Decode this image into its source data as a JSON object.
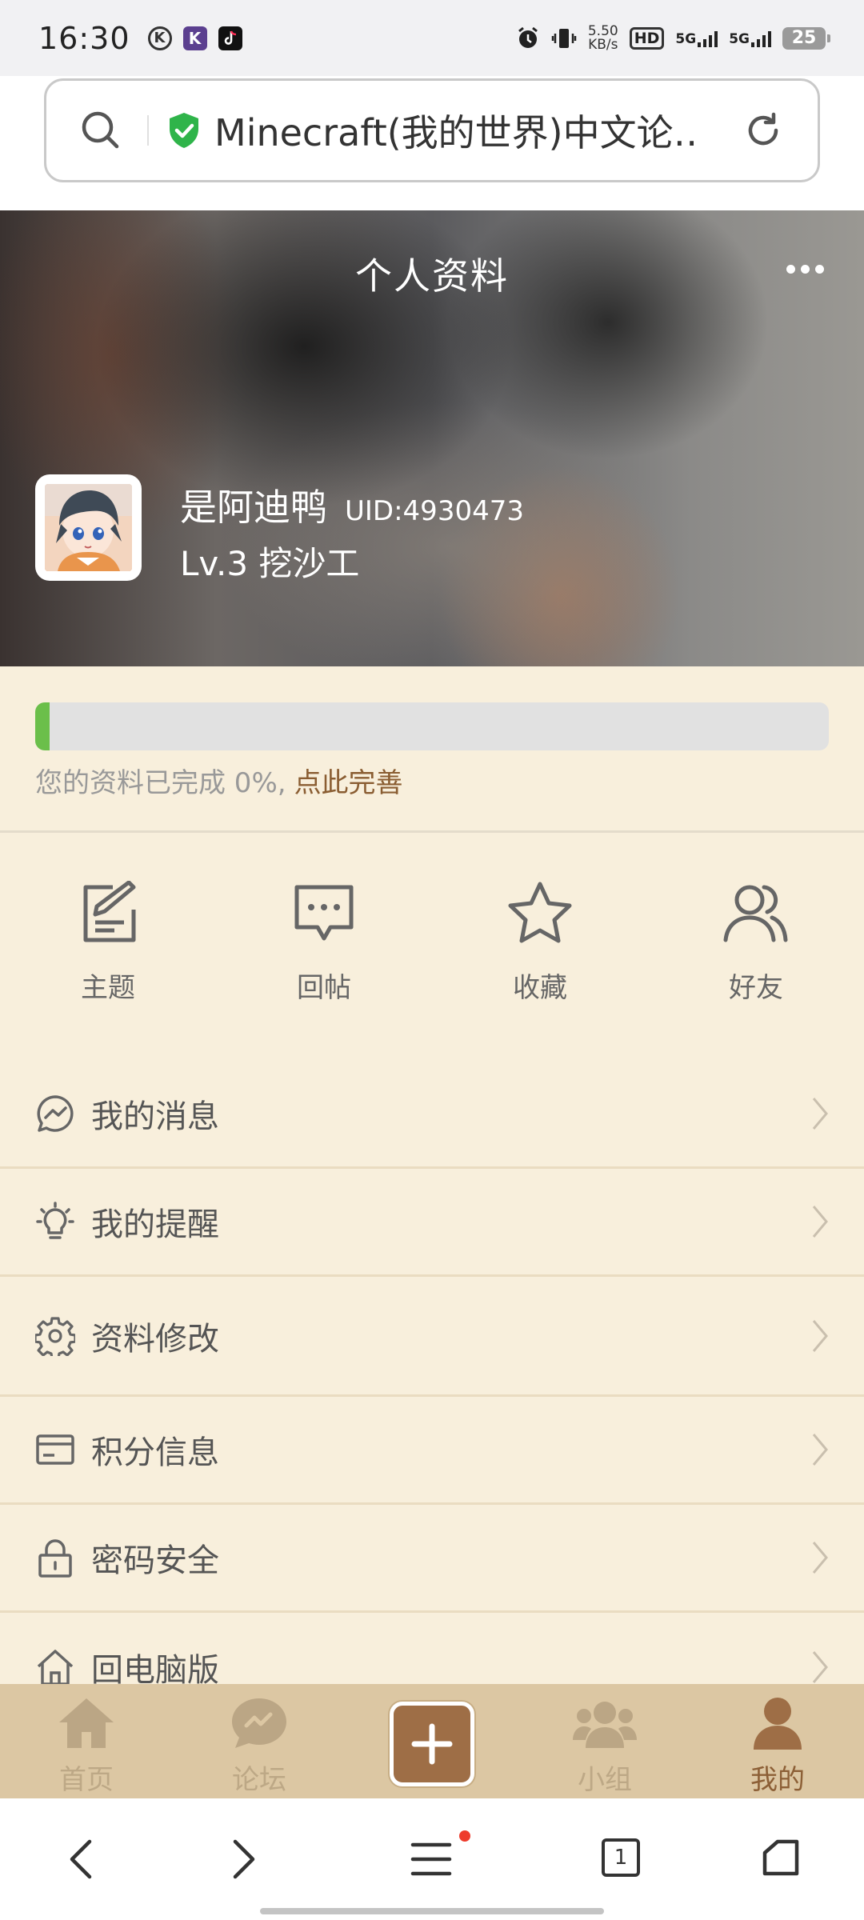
{
  "status_bar": {
    "time": "16:30",
    "speed_value": "5.50",
    "speed_unit": "KB/s",
    "hd": "HD",
    "net1": "5G",
    "net2": "5G",
    "battery": "25"
  },
  "address_bar": {
    "url_text": "Minecraft(我的世界)中文论…"
  },
  "header": {
    "title": "个人资料",
    "username": "是阿迪鸭",
    "uid": "UID:4930473",
    "level": "Lv.3 挖沙工"
  },
  "profile_completion": {
    "percent": 0,
    "text": "您的资料已完成 0%,",
    "link": "点此完善",
    "accent": "#6bbf4a"
  },
  "actions": [
    {
      "label": "主题",
      "icon": "edit-icon"
    },
    {
      "label": "回帖",
      "icon": "comment-icon"
    },
    {
      "label": "收藏",
      "icon": "star-icon"
    },
    {
      "label": "好友",
      "icon": "friends-icon"
    }
  ],
  "menu": [
    {
      "label": "我的消息",
      "icon": "message-icon"
    },
    {
      "label": "我的提醒",
      "icon": "bulb-icon"
    },
    {
      "label": "资料修改",
      "icon": "gear-icon"
    },
    {
      "label": "积分信息",
      "icon": "card-icon"
    },
    {
      "label": "密码安全",
      "icon": "lock-icon"
    },
    {
      "label": "回电脑版",
      "icon": "home-icon"
    }
  ],
  "tabbar": {
    "items": [
      {
        "label": "首页",
        "icon": "home-icon",
        "active": false
      },
      {
        "label": "论坛",
        "icon": "forum-icon",
        "active": false
      },
      {
        "label": "",
        "icon": "plus-icon",
        "active": false
      },
      {
        "label": "小组",
        "icon": "group-icon",
        "active": false
      },
      {
        "label": "我的",
        "icon": "user-icon",
        "active": true
      }
    ]
  },
  "browser_nav": {
    "tab_count": "1"
  },
  "colors": {
    "page_bg": "#f8efdc",
    "tabbar_bg": "#dcc7a3",
    "accent_brown": "#8c5f36",
    "progress_green": "#6bbf4a"
  }
}
